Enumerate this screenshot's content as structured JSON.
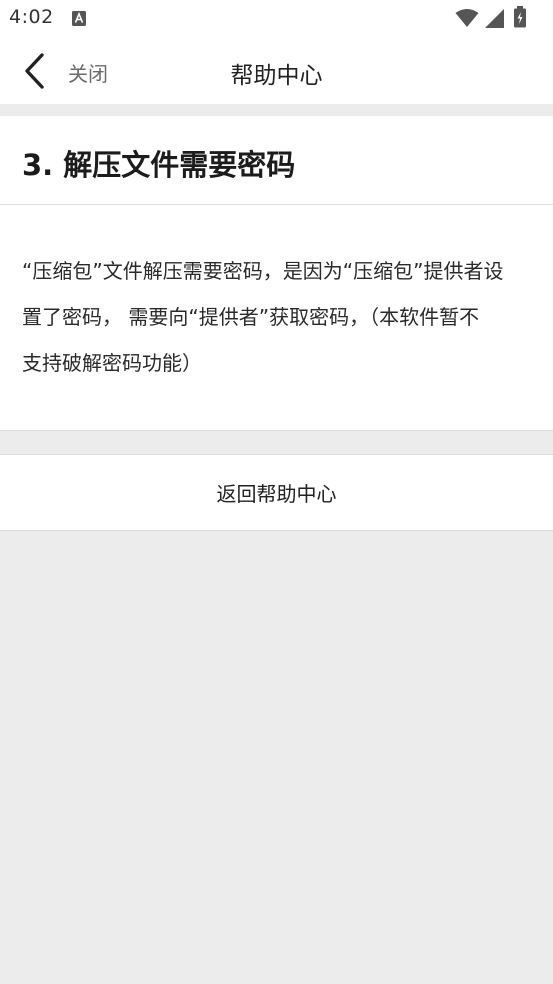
{
  "status_bar": {
    "time": "4:02",
    "app_icon": "a-icon",
    "icons": [
      "wifi-icon",
      "signal-icon",
      "battery-icon"
    ]
  },
  "nav": {
    "back_icon": "chevron-left-icon",
    "close_label": "关闭",
    "title": "帮助中心"
  },
  "article": {
    "title": "3. 解压文件需要密码",
    "body_lines": [
      "“压缩包”文件解压需要密码，是因为“压缩包”提供者设",
      "置了密码， 需要向“提供者”获取密码，（本软件暂不",
      "支持破解密码功能）"
    ]
  },
  "footer": {
    "return_label": "返回帮助中心"
  },
  "colors": {
    "background": "#ececec",
    "surface": "#ffffff",
    "text_primary": "#222222",
    "text_secondary": "#6b6b6b"
  }
}
